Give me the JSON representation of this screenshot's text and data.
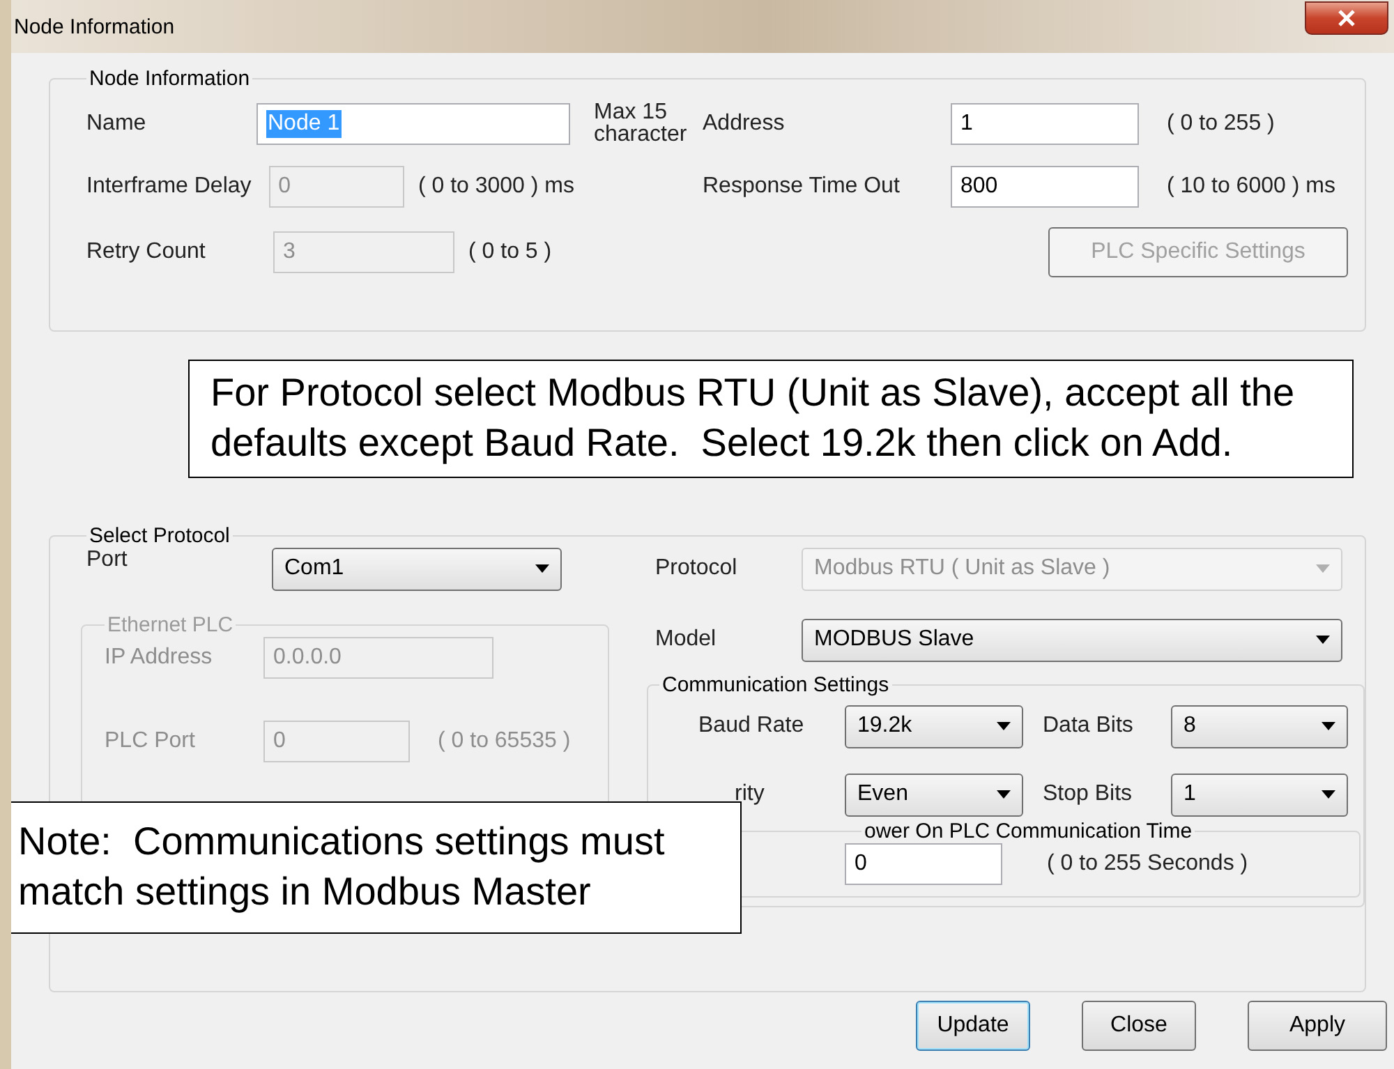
{
  "window": {
    "title": "Node Information"
  },
  "node_information": {
    "title": "Node Information",
    "name": {
      "label": "Name",
      "value": "Node 1",
      "text_selected": true,
      "note": "Max 15 character"
    },
    "interframe_delay": {
      "label": "Interframe Delay",
      "value": "0",
      "disabled": true,
      "range": "( 0 to 3000 ) ms"
    },
    "retry_count": {
      "label": "Retry Count",
      "value": "3",
      "disabled": true,
      "range": "( 0 to 5 )"
    },
    "address": {
      "label": "Address",
      "value": "1",
      "disabled": false,
      "range": "( 0 to 255 )"
    },
    "response_time_out": {
      "label": "Response Time Out",
      "value": "800",
      "disabled": false,
      "range": "( 10 to 6000 ) ms"
    },
    "plc_specific_settings": {
      "label": "PLC Specific Settings",
      "disabled": true
    }
  },
  "callouts": [
    {
      "text": "For Protocol select Modbus RTU (Unit as Slave), accept all the defaults except Baud Rate.  Select 19.2k then click on Add."
    },
    {
      "text": "Note:  Communications settings must match settings in Modbus Master"
    }
  ],
  "select_protocol": {
    "title": "Select Protocol",
    "port": {
      "label": "Port",
      "value": "Com1"
    },
    "ethernet_plc": {
      "title": "Ethernet PLC",
      "disabled": true,
      "ip_address": {
        "label": "IP Address",
        "value": "0.0.0.0"
      },
      "plc_port": {
        "label": "PLC Port",
        "value": "0",
        "range": "( 0 to 65535 )"
      }
    },
    "protocol": {
      "label": "Protocol",
      "value": "Modbus RTU ( Unit as Slave )",
      "disabled": true
    },
    "model": {
      "label": "Model",
      "value": "MODBUS Slave",
      "disabled": false
    },
    "communication_settings": {
      "title": "Communication Settings",
      "baud_rate": {
        "label": "Baud Rate",
        "value": "19.2k"
      },
      "data_bits": {
        "label": "Data Bits",
        "value": "8"
      },
      "parity": {
        "label": "rity",
        "value": "Even"
      },
      "stop_bits": {
        "label": "Stop Bits",
        "value": "1"
      },
      "power_on": {
        "title": "ower On PLC Communication Time",
        "value": "0",
        "range": "( 0 to 255 Seconds )"
      }
    }
  },
  "buttons": [
    {
      "label": "Update",
      "focused": true
    },
    {
      "label": "Close",
      "focused": false
    },
    {
      "label": "Apply",
      "focused": false
    }
  ]
}
